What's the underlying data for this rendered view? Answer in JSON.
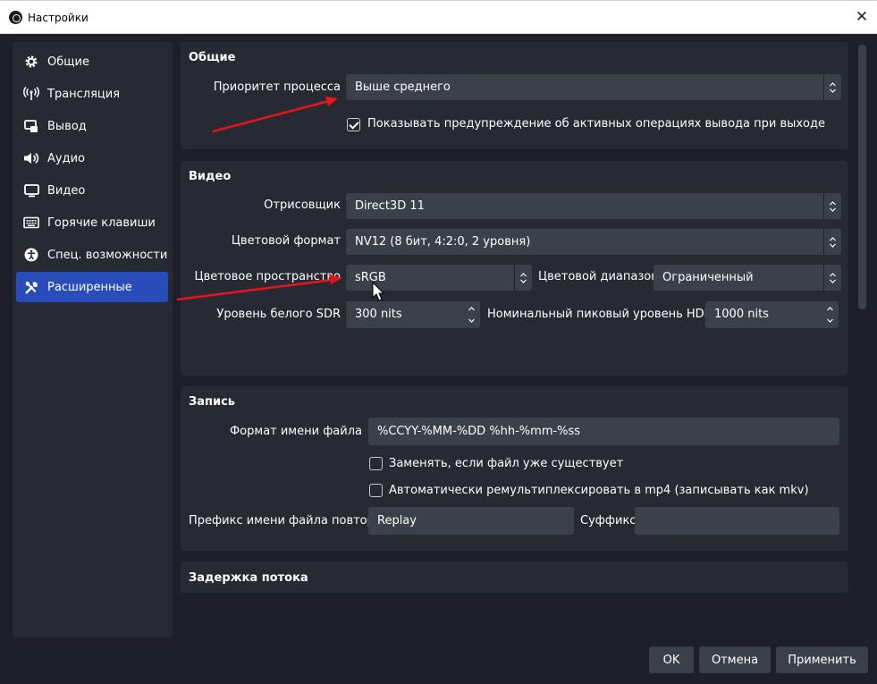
{
  "window": {
    "title": "Настройки",
    "close_glyph": "✕"
  },
  "sidebar": {
    "items": [
      {
        "label": "Общие",
        "icon": "gear-icon"
      },
      {
        "label": "Трансляция",
        "icon": "broadcast-icon"
      },
      {
        "label": "Вывод",
        "icon": "output-icon"
      },
      {
        "label": "Аудио",
        "icon": "speaker-icon"
      },
      {
        "label": "Видео",
        "icon": "monitor-icon"
      },
      {
        "label": "Горячие клавиши",
        "icon": "keyboard-icon"
      },
      {
        "label": "Спец. возможности",
        "icon": "accessibility-icon"
      },
      {
        "label": "Расширенные",
        "icon": "tools-icon",
        "active": true
      }
    ]
  },
  "general": {
    "title": "Общие",
    "priority_label": "Приоритет процесса",
    "priority_value": "Выше среднего",
    "warn_checkbox_label": "Показывать предупреждение об активных операциях вывода при выходе",
    "warn_checked": true
  },
  "video": {
    "title": "Видео",
    "renderer_label": "Отрисовщик",
    "renderer_value": "Direct3D 11",
    "color_format_label": "Цветовой формат",
    "color_format_value": "NV12 (8 бит, 4:2:0, 2 уровня)",
    "color_space_label": "Цветовое пространство",
    "color_space_value": "sRGB",
    "color_range_label": "Цветовой диапазон",
    "color_range_value": "Ограниченный",
    "sdr_white_label": "Уровень белого SDR",
    "sdr_white_value": "300 nits",
    "hdr_peak_label": "Номинальный пиковый уровень HDR",
    "hdr_peak_value": "1000 nits"
  },
  "recording": {
    "title": "Запись",
    "filename_format_label": "Формат имени файла",
    "filename_format_value": "%CCYY-%MM-%DD %hh-%mm-%ss",
    "overwrite_label": "Заменять, если файл уже существует",
    "overwrite_checked": false,
    "remux_label": "Автоматически ремультиплексировать в mp4 (записывать как mkv)",
    "remux_checked": false,
    "replay_prefix_label": "Префикс имени файла повтора",
    "replay_prefix_value": "Replay",
    "suffix_label": "Суффикс",
    "suffix_value": ""
  },
  "stream_delay": {
    "title": "Задержка потока"
  },
  "buttons": {
    "ok": "OK",
    "cancel": "Отмена",
    "apply": "Применить"
  },
  "colors": {
    "accent": "#284cb8",
    "background": "#1e1f29",
    "panel": "#272a33",
    "field": "#3c404b",
    "annotation": "#e8141c"
  }
}
